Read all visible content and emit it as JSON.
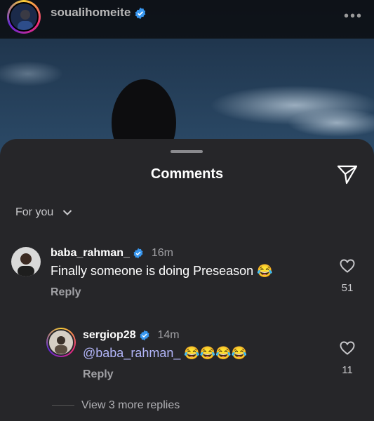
{
  "post": {
    "username": "soualihomeite"
  },
  "sheet": {
    "title": "Comments",
    "filter_label": "For you"
  },
  "comments": [
    {
      "username": "baba_rahman_",
      "time": "16m",
      "text": "Finally someone is doing Preseason",
      "emoji": "😂",
      "reply_label": "Reply",
      "likes": "51"
    },
    {
      "username": "sergiop28",
      "time": "14m",
      "mention": "@baba_rahman_",
      "emoji": "😂😂😂😂",
      "reply_label": "Reply",
      "likes": "11"
    }
  ],
  "view_more_replies": "View 3 more replies",
  "colors": {
    "sheet_bg": "#262629",
    "verified": "#3897f0",
    "mention": "#b2b5f8"
  },
  "icons": [
    "verified-badge-icon",
    "more-options-icon",
    "share-icon",
    "chevron-down-icon",
    "heart-icon"
  ]
}
